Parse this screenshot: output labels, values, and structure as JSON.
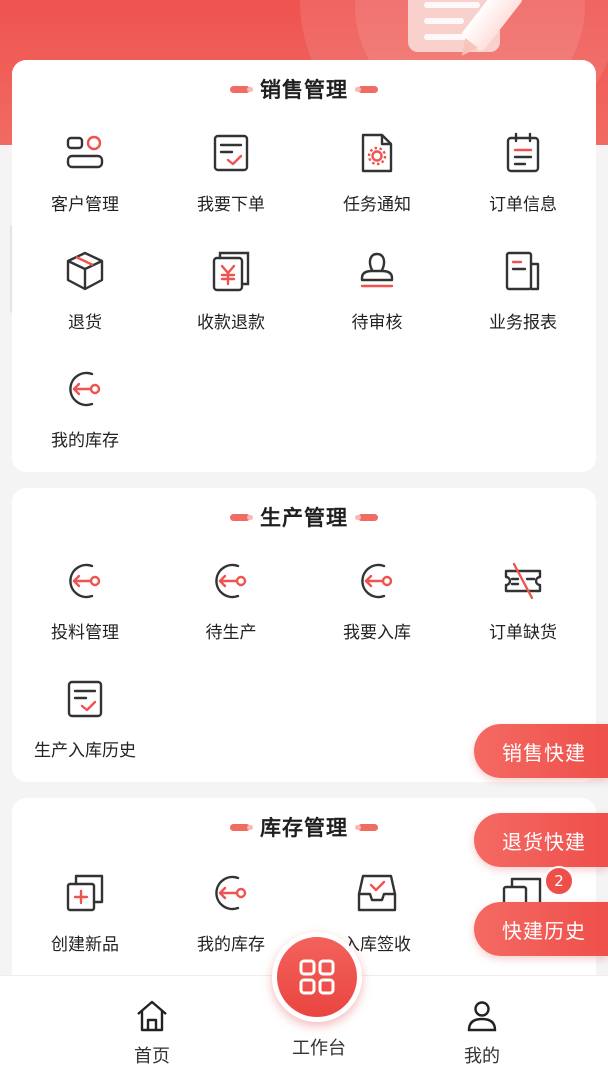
{
  "sections": {
    "sales": {
      "title": "销售管理",
      "items": [
        "客户管理",
        "我要下单",
        "任务通知",
        "订单信息",
        "退货",
        "收款退款",
        "待审核",
        "业务报表",
        "我的库存"
      ]
    },
    "production": {
      "title": "生产管理",
      "items": [
        "投料管理",
        "待生产",
        "我要入库",
        "订单缺货",
        "生产入库历史"
      ]
    },
    "inventory": {
      "title": "库存管理",
      "items": [
        "创建新品",
        "我的库存",
        "入库签收"
      ]
    }
  },
  "floating": {
    "sales_quick": "销售快建",
    "return_quick": "退货快建",
    "quick_history": "快建历史",
    "badge_count": "2"
  },
  "tabbar": {
    "home": "首页",
    "workbench": "工作台",
    "mine": "我的"
  },
  "colors": {
    "accent": "#ef5350",
    "icon_dark": "#333333"
  }
}
